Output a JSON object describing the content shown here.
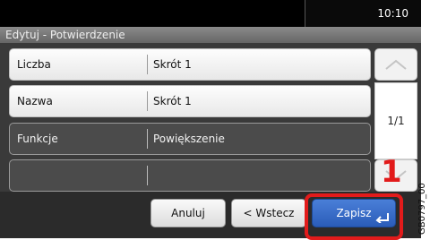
{
  "status": {
    "time": "10:10"
  },
  "header": {
    "title": "Edytuj - Potwierdzenie"
  },
  "rows": [
    {
      "label": "Liczba",
      "value": "Skrót 1"
    },
    {
      "label": "Nazwa",
      "value": "Skrót 1"
    },
    {
      "label": "Funkcje",
      "value": "Powiększenie"
    },
    {
      "label": "",
      "value": ""
    }
  ],
  "scroll": {
    "page_indicator": "1/1",
    "up_icon": "chevron-up-icon",
    "down_icon": "chevron-down-icon"
  },
  "buttons": {
    "cancel": "Anuluj",
    "back": "< Wstecz",
    "save": "Zapisz",
    "save_icon": "enter-icon"
  },
  "annotation": {
    "callout": "1",
    "side_code": "GB0797_00"
  },
  "colors": {
    "accent_blue": "#2a5cb8",
    "highlight_red": "#e21b1b"
  }
}
